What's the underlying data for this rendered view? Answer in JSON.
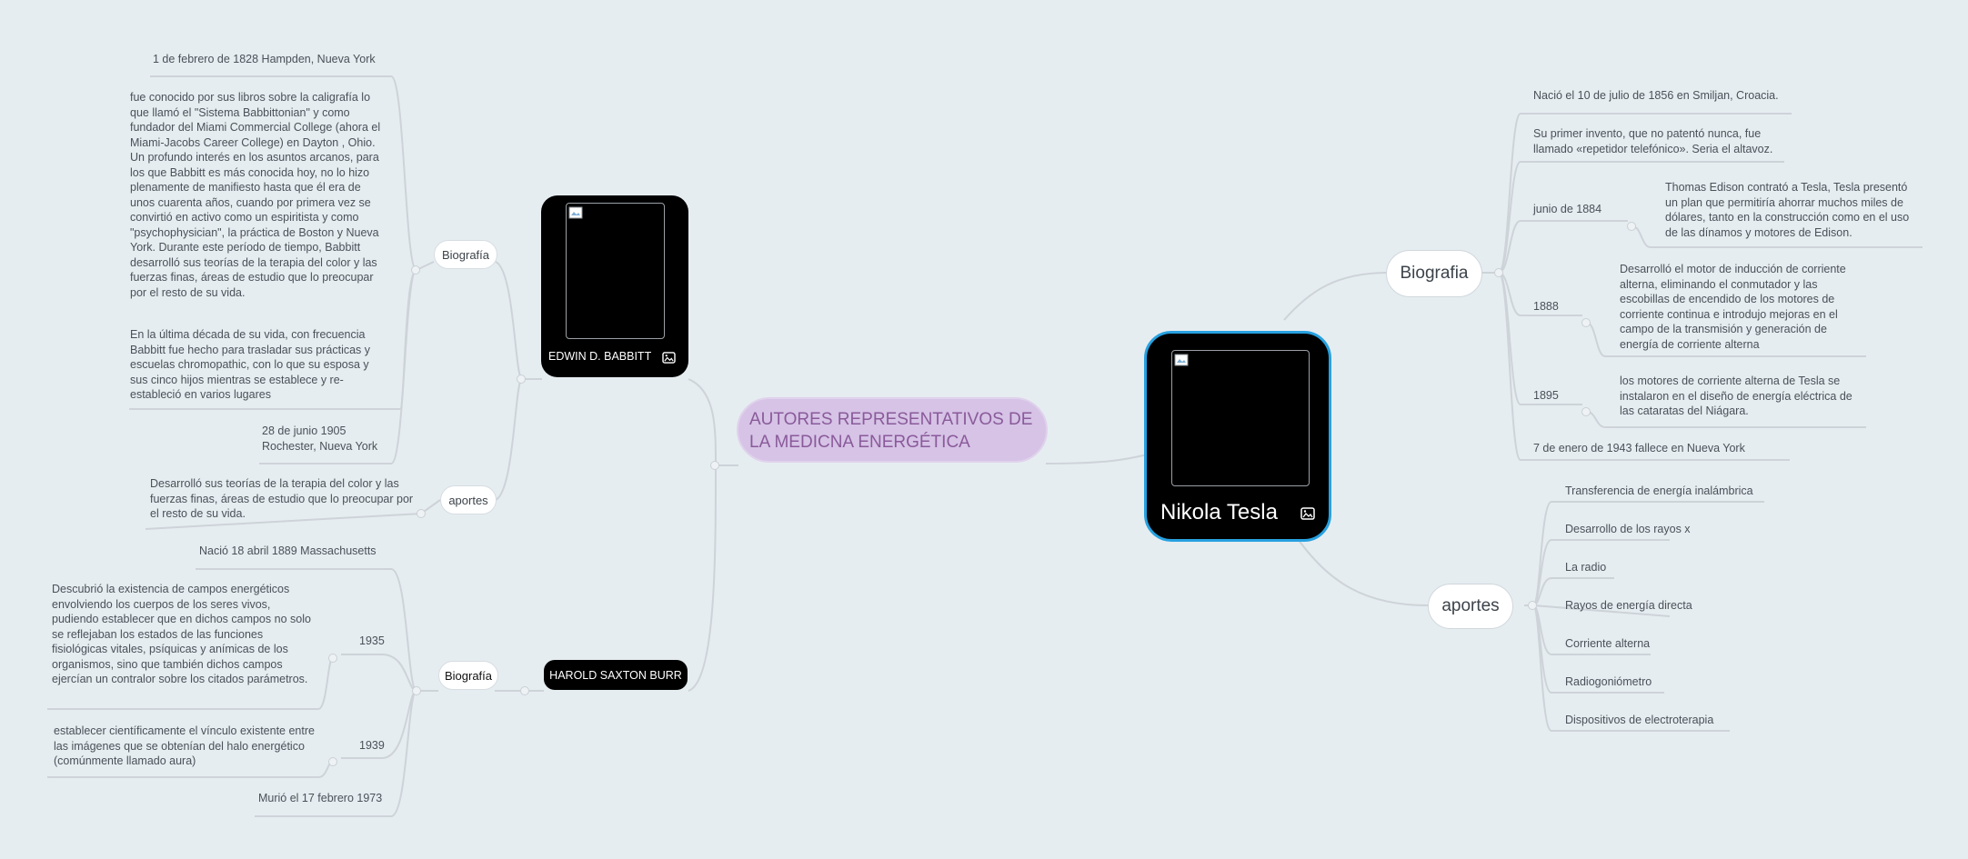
{
  "central": {
    "title": "AUTORES REPRESENTATIVOS DE LA MEDICNA ENERGÉTICA"
  },
  "tesla": {
    "name": "Nikola Tesla",
    "biografia": {
      "label": "Biografia",
      "items": [
        {
          "text": "Nació el 10 de julio de 1856 en Smiljan, Croacia."
        },
        {
          "text": "Su primer invento, que no patentó nunca, fue llamado «repetidor telefónico». Seria el altavoz."
        },
        {
          "label": "junio de 1884",
          "text": "Thomas Edison contrató a Tesla, Tesla presentó un plan que permitiría ahorrar muchos miles de dólares, tanto en la construcción como en el uso de las dínamos y motores de Edison."
        },
        {
          "label": "1888",
          "text": "Desarrolló el motor de inducción de corriente alterna, eliminando el conmutador y las escobillas de encendido de los motores de corriente continua e introdujo mejoras en el campo de la transmisión y generación de energía de corriente alterna"
        },
        {
          "label": "1895",
          "text": "los motores de corriente alterna de Tesla se instalaron en el diseño de energía eléctrica de las cataratas del Niágara."
        },
        {
          "text": "7 de enero de 1943 fallece en Nueva York"
        }
      ]
    },
    "aportes": {
      "label": "aportes",
      "items": [
        "Transferencia de energía inalámbrica",
        "Desarrollo de los rayos x",
        "La radio",
        "Rayos de energía directa",
        "Corriente alterna",
        "Radiogoniómetro",
        "Dispositivos de electroterapia"
      ]
    }
  },
  "babbitt": {
    "name": "EDWIN D. BABBITT",
    "biografia": {
      "label": "Biografía",
      "items": [
        "1 de febrero de 1828 Hampden, Nueva York",
        "fue conocido por sus libros sobre la caligrafía lo que llamó el \"Sistema Babbittonian\"  y como fundador del Miami Commercial College (ahora el Miami-Jacobs Career College) en Dayton , Ohio. Un profundo interés en los asuntos arcanos, para los que Babbitt es más conocida hoy, no lo hizo plenamente de manifiesto hasta que él era de unos cuarenta años, cuando por primera vez se convirtió en activo como un espiritista y como \"psychophysician\", la práctica de Boston y Nueva York. Durante este período de tiempo, Babbitt desarrolló sus teorías de la terapia del color y las fuerzas finas, áreas de estudio que lo preocupar por el resto de su vida.",
        "En la última década de su vida, con frecuencia Babbitt fue hecho para trasladar sus prácticas y escuelas chromopathic, con lo que su esposa y sus cinco hijos mientras se establece y re-estableció en varios lugares",
        "28 de junio 1905 Rochester, Nueva York"
      ]
    },
    "aportes": {
      "label": "aportes",
      "text": "Desarrolló sus teorías de la terapia del color y las fuerzas finas, áreas de estudio que lo preocupar por el resto de su vida."
    }
  },
  "burr": {
    "name": "HAROLD SAXTON BURR",
    "biografia": {
      "label": "Biografía",
      "born": "Nació 18 abril 1889  Massachusetts",
      "events": [
        {
          "label": "1935",
          "text": "Descubrió la existencia de campos energéticos envolviendo los cuerpos de los seres vivos, pudiendo establecer que en dichos campos no solo se reflejaban los estados de las funciones fisiológicas vitales, psíquicas y anímicas de los organismos, sino que también dichos campos ejercían un contralor sobre los citados parámetros."
        },
        {
          "label": "1939",
          "text": "establecer científicamente el vínculo existente entre las imágenes que se obtenían del halo energético (comúnmente llamado aura)"
        }
      ],
      "died": "Murió el 17 febrero 1973"
    }
  },
  "colors": {
    "background": "#e6edf1",
    "connector": "#cdd3d8",
    "title_fill": "#d6c3e6",
    "title_text": "#8a5a9a",
    "card": "#000000",
    "tesla_border": "#27a1e0"
  },
  "icons": [
    "image-icon",
    "broken-image-icon"
  ]
}
